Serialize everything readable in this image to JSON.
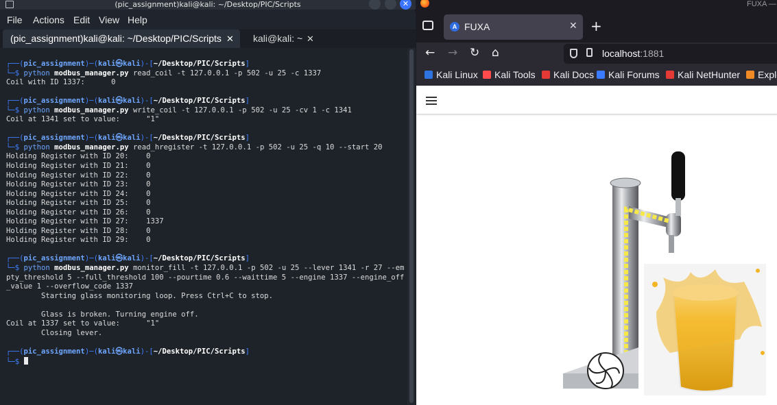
{
  "terminal": {
    "window_title": "(pic_assignment)kali@kali: ~/Desktop/PIC/Scripts",
    "close_glyph": "✕",
    "menu": [
      "File",
      "Actions",
      "Edit",
      "View",
      "Help"
    ],
    "tabs": [
      {
        "label": "(pic_assignment)kali@kali: ~/Desktop/PIC/Scripts",
        "close": "✕"
      },
      {
        "label": "kali@kali: ~",
        "close": "✕"
      }
    ],
    "prompt": {
      "top_left": "┌──(",
      "env": "pic_assignment",
      "mid": ")─(",
      "user": "kali",
      "at": "㉿",
      "host": "kali",
      "end": ")-[",
      "dir": "~/Desktop/PIC/Scripts",
      "close": "]",
      "bottom": "└─$ "
    },
    "commands": [
      {
        "bin": "modbus_manager.py",
        "args": " read_coil -t 127.0.0.1 -p 502 -u 25 -c 1337"
      },
      {
        "bin": "modbus_manager.py",
        "args": " write_coil -t 127.0.0.1 -p 502 -u 25 -cv 1 -c 1341"
      },
      {
        "bin": "modbus_manager.py",
        "args": " read_hregister -t 127.0.0.1 -p 502 -u 25 -q 10 --start 20"
      },
      {
        "bin": "modbus_manager.py",
        "args": " monitor_fill -t 127.0.0.1 -p 502 -u 25 --lever 1341 -r 27 --em",
        "wrap": [
          "pty_threshold 5 --full_threshold 100 --pourtime 0.6 --waittime 5 --engine 1337 --engine_off",
          "_value 1 --overflow_code 1337"
        ]
      }
    ],
    "python": "python ",
    "out_read_coil": "Coil with ID 1337:      0",
    "out_write_coil": "Coil at 1341 set to value:      \"1\"",
    "holding_registers": [
      "Holding Register with ID 20:    0",
      "Holding Register with ID 21:    0",
      "Holding Register with ID 22:    0",
      "Holding Register with ID 23:    0",
      "Holding Register with ID 24:    0",
      "Holding Register with ID 25:    0",
      "Holding Register with ID 26:    0",
      "Holding Register with ID 27:    1337",
      "Holding Register with ID 28:    0",
      "Holding Register with ID 29:    0"
    ],
    "monitor_output": [
      "        Starting glass monitoring loop. Press Ctrl+C to stop.",
      "",
      "        Glass is broken. Turning engine off.",
      "Coil at 1337 set to value:      \"1\"",
      "        Closing lever."
    ]
  },
  "browser": {
    "window_title": "FUXA —",
    "tab_title": "FUXA",
    "tab_favicon_letter": "A",
    "tab_close": "✕",
    "new_tab": "+",
    "nav": {
      "back": "←",
      "forward": "→",
      "reload": "↻",
      "home": "⌂"
    },
    "url_host": "localhost",
    "url_port": ":1881",
    "bookmarks": [
      {
        "label": "Kali Linux",
        "color": "#2f73e0"
      },
      {
        "label": "Kali Tools",
        "color": "#ff4b4b"
      },
      {
        "label": "Kali Docs",
        "color": "#e53935"
      },
      {
        "label": "Kali Forums",
        "color": "#3a7bff"
      },
      {
        "label": "Kali NetHunter",
        "color": "#e53935"
      },
      {
        "label": "Exploit-DB",
        "color": "#f08a24"
      }
    ],
    "bookmarks_partial_last": "Explo"
  },
  "colors": {
    "terminal_bg": "#1e232a",
    "prompt_blue": "#3f80ff",
    "highlight_yellow": "#f7e84a"
  }
}
